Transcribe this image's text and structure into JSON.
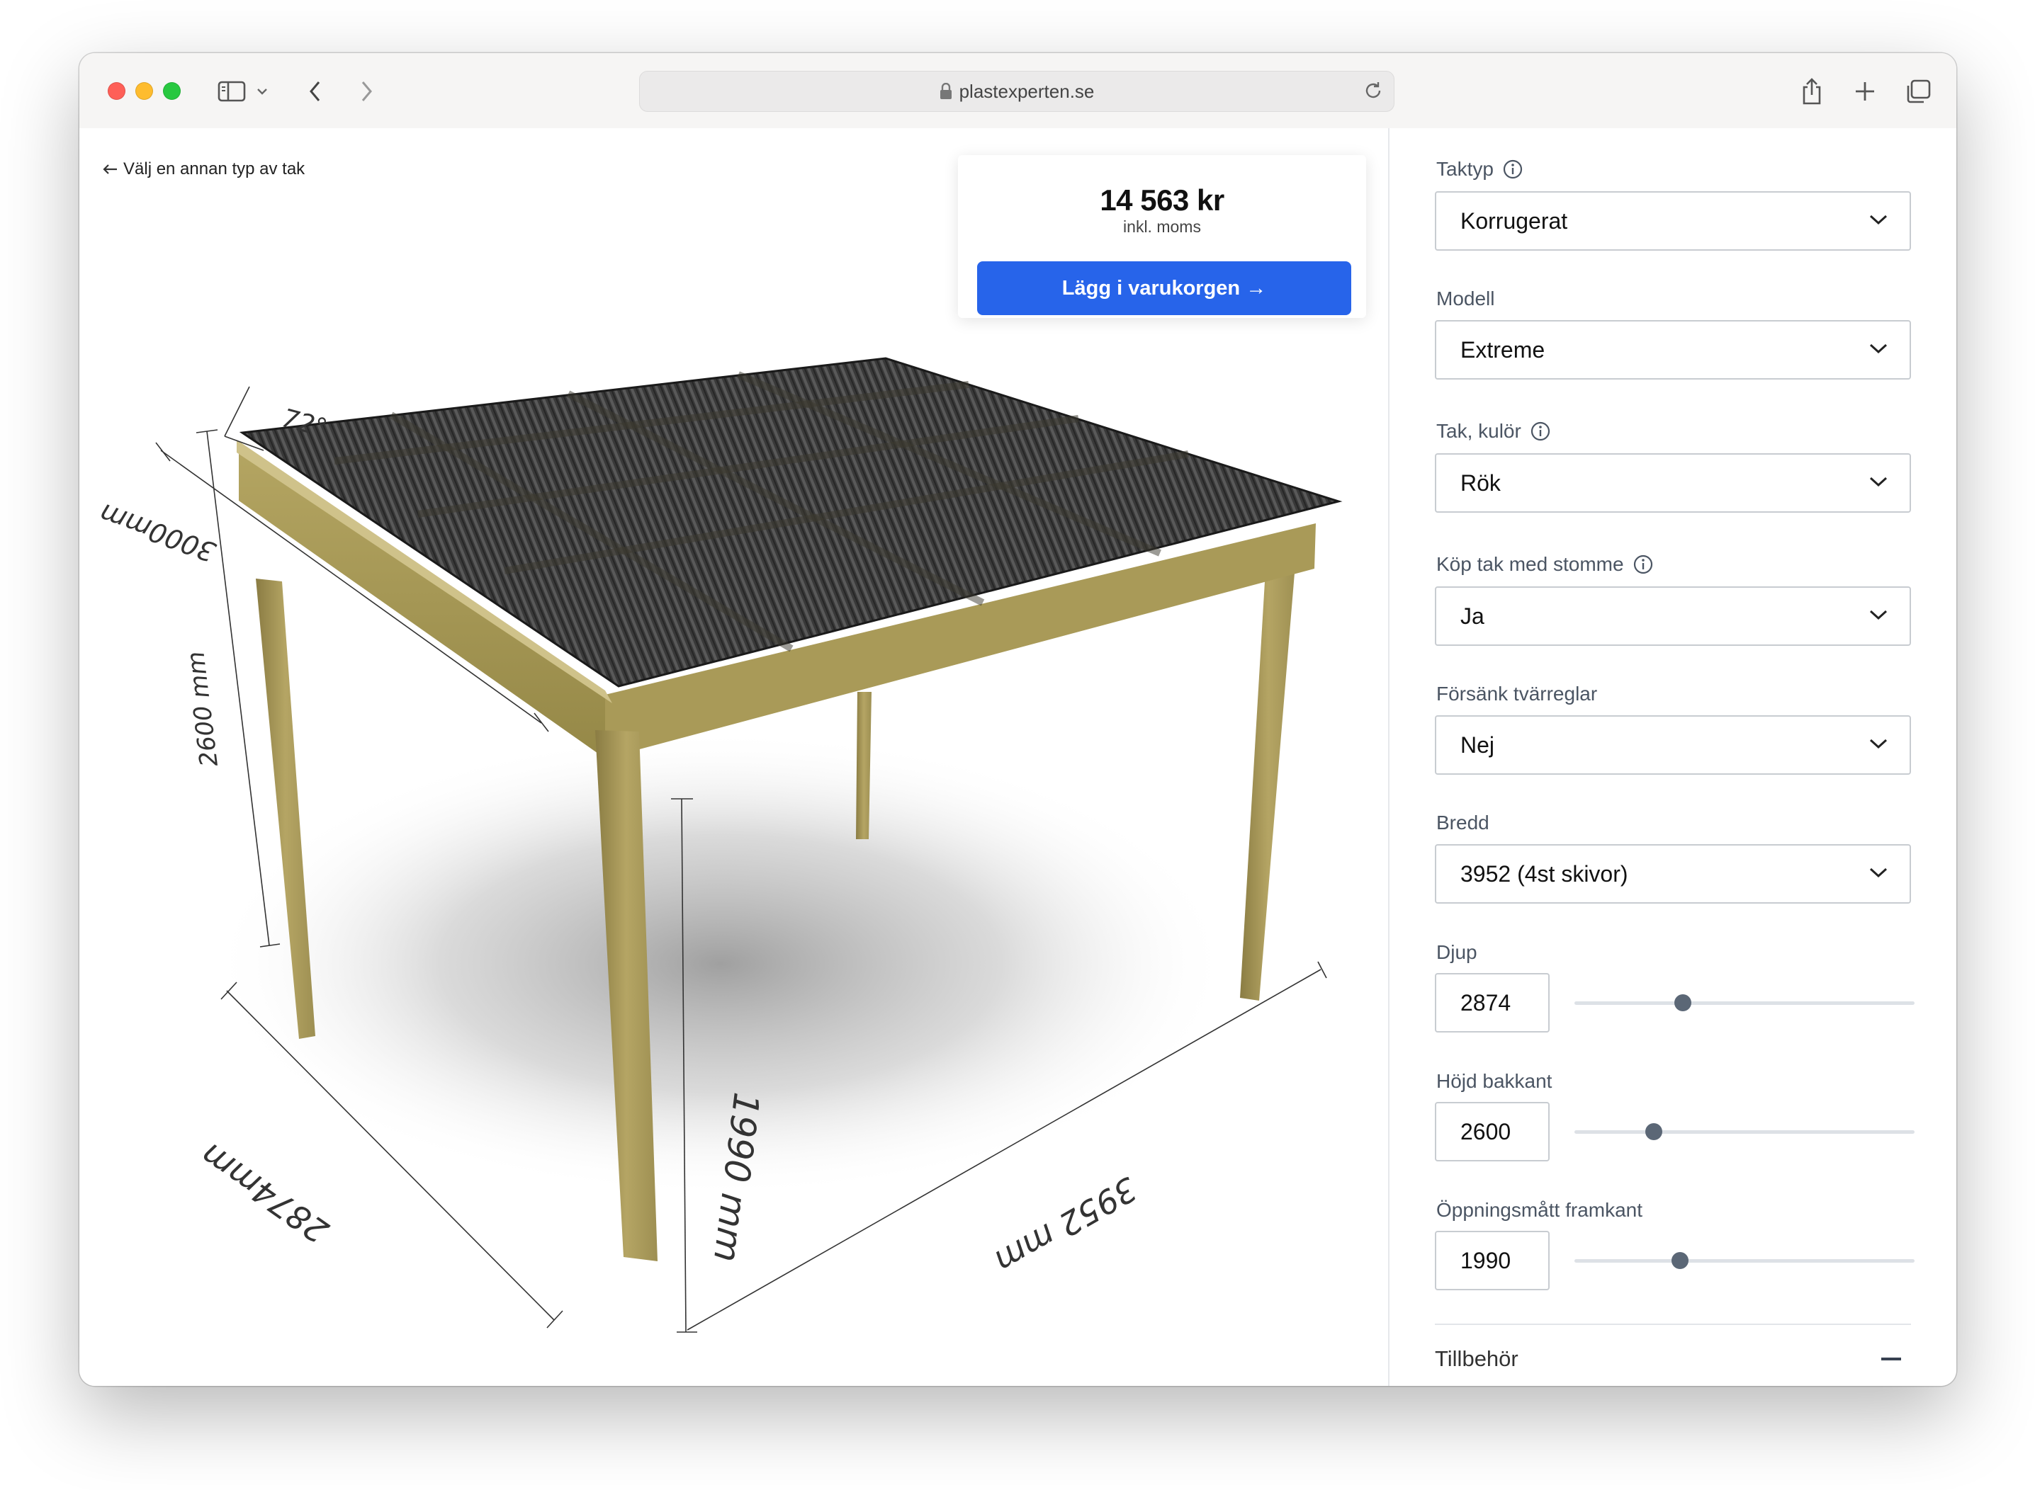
{
  "browser": {
    "url": "plastexperten.se"
  },
  "page": {
    "back_link": "Välj en annan typ av tak",
    "price": "14 563 kr",
    "price_note": "inkl. moms",
    "cart_button": "Lägg i varukorgen →"
  },
  "dimensions": {
    "angle": "72°",
    "top_depth": "3000mm",
    "side_height": "2600 mm",
    "front_opening": "1990 mm",
    "depth": "2874mm",
    "width": "3952 mm"
  },
  "config": {
    "taktyp": {
      "label": "Taktyp",
      "value": "Korrugerat"
    },
    "modell": {
      "label": "Modell",
      "value": "Extreme"
    },
    "kulor": {
      "label": "Tak, kulör",
      "value": "Rök"
    },
    "stomme": {
      "label": "Köp tak med stomme",
      "value": "Ja"
    },
    "tvarreglar": {
      "label": "Försänk tvärreglar",
      "value": "Nej"
    },
    "bredd": {
      "label": "Bredd",
      "value": "3952 (4st skivor)"
    },
    "djup": {
      "label": "Djup",
      "value": "2874",
      "slider_fraction": 0.31
    },
    "hojd": {
      "label": "Höjd bakkant",
      "value": "2600",
      "slider_fraction": 0.22
    },
    "oppning": {
      "label": "Öppningsmått framkant",
      "value": "1990",
      "slider_fraction": 0.3
    },
    "tillbehor": {
      "label": "Tillbehör"
    }
  }
}
